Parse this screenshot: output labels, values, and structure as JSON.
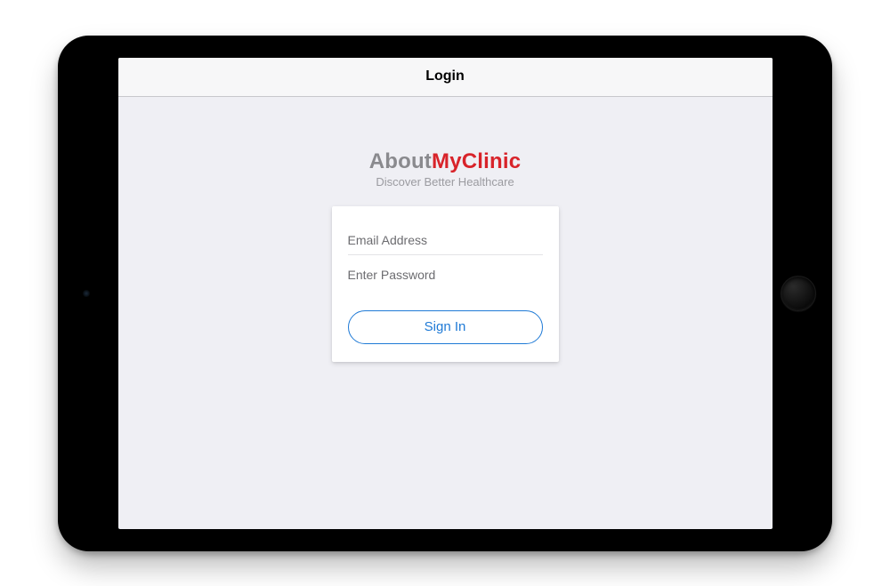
{
  "header": {
    "title": "Login"
  },
  "brand": {
    "part1": "About",
    "part2": "MyClinic",
    "tagline": "Discover Better Healthcare"
  },
  "form": {
    "email_placeholder": "Email Address",
    "password_placeholder": "Enter Password",
    "signin_label": "Sign In"
  },
  "colors": {
    "accent_red": "#d8232a",
    "accent_blue": "#1f7ad6"
  }
}
